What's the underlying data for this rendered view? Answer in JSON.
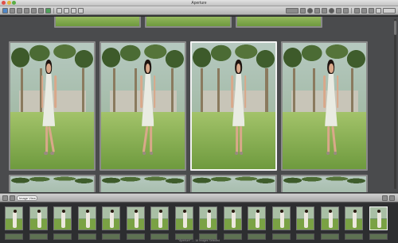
{
  "window": {
    "title": "Aperture"
  },
  "toolbar": {
    "left_icons": [
      "import-icon",
      "new-project-icon",
      "new-album-icon",
      "email-icon",
      "print-icon",
      "backup-icon",
      "export-icon",
      "rotate-left-icon",
      "rotate-right-icon",
      "stack-icon",
      "compare-icon"
    ],
    "right_icons": [
      "viewer-mode-icon",
      "full-screen-icon",
      "loupe-icon",
      "crop-icon",
      "straighten-icon",
      "red-eye-icon",
      "spot-patch-icon",
      "lift-stamp-icon",
      "adjust-icon",
      "metadata-icon",
      "inspector-icon",
      "rating-icon",
      "zoom-icon"
    ]
  },
  "viewer": {
    "photo_count_visible": 4,
    "selected_index": 2
  },
  "browser_bar": {
    "search_placeholder": "Image View",
    "icons": [
      "grid-view-icon",
      "list-view-icon",
      "filter-icon"
    ]
  },
  "filmstrip": {
    "thumb_count": 16,
    "active_index": 15,
    "status_text": "\"Aperture\" — 16 Images Selected"
  },
  "colors": {
    "selection": "#f2f2f2",
    "background": "#3a3b3d",
    "accent": "#4f86c6"
  }
}
